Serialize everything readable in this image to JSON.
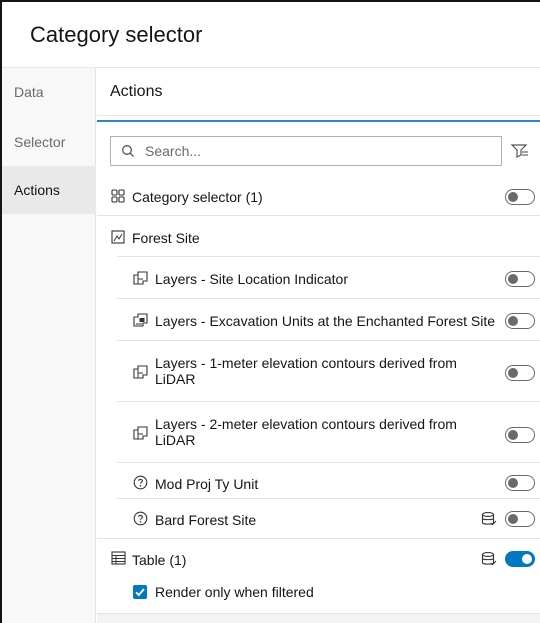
{
  "window": {
    "title": "Category selector"
  },
  "sidebar": {
    "items": [
      {
        "label": "Data",
        "active": false
      },
      {
        "label": "Selector",
        "active": false
      },
      {
        "label": "Actions",
        "active": true
      }
    ]
  },
  "main": {
    "section_title": "Actions",
    "search": {
      "placeholder": "Search...",
      "value": ""
    },
    "filter_icon": "filter-list-icon",
    "category_row": {
      "label": "Category selector (1)",
      "icon": "grid-widget-icon",
      "enabled": false
    },
    "group": {
      "label": "Forest Site",
      "icon": "map-frame-icon"
    },
    "layers": [
      {
        "label": "Layers - Site Location Indicator",
        "icon": "layer-point-icon",
        "enabled": false,
        "has_data_source": false
      },
      {
        "label": "Layers - Excavation Units at the Enchanted Forest Site",
        "icon": "layer-polygon-icon",
        "enabled": false,
        "has_data_source": false
      },
      {
        "label": "Layers - 1-meter elevation contours derived from",
        "label_line2": "LiDAR",
        "icon": "layer-point-icon",
        "enabled": false,
        "has_data_source": false
      },
      {
        "label": "Layers - 2-meter elevation contours derived from",
        "label_line2": "LiDAR",
        "icon": "layer-point-icon",
        "enabled": false,
        "has_data_source": false
      },
      {
        "label": "Mod Proj Ty Unit",
        "icon": "question-circle-icon",
        "enabled": false,
        "has_data_source": false
      },
      {
        "label": "Bard Forest Site",
        "icon": "question-circle-icon",
        "enabled": false,
        "has_data_source": true
      }
    ],
    "table_row": {
      "label": "Table (1)",
      "icon": "table-icon",
      "enabled": true,
      "has_data_source": true
    },
    "render_option": {
      "label": "Render only when filtered",
      "checked": true
    }
  },
  "colors": {
    "accent": "#0079c1",
    "accent_bar": "#2f86c7",
    "text": "#151515",
    "muted": "#6a6a6a"
  }
}
